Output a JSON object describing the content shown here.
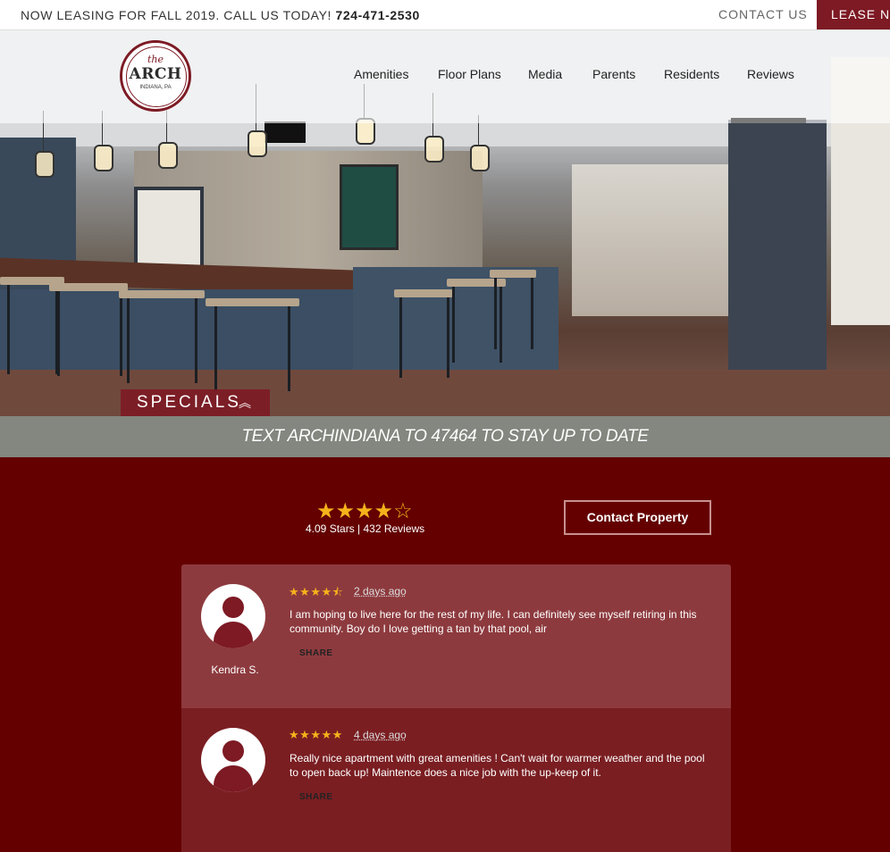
{
  "topbar": {
    "message": "NOW LEASING FOR FALL 2019. CALL US TODAY!",
    "phone": "724-471-2530",
    "contact_label": "CONTACT US",
    "lease_label": "LEASE NOW"
  },
  "logo": {
    "the": "the",
    "name": "ARCH",
    "location": "INDIANA, PA"
  },
  "nav": {
    "items": [
      {
        "label": "Amenities"
      },
      {
        "label": "Floor Plans"
      },
      {
        "label": "Media"
      },
      {
        "label": "Parents"
      },
      {
        "label": "Residents"
      },
      {
        "label": "Reviews"
      }
    ],
    "active": "Reviews"
  },
  "specials": {
    "label": "SPECIALS",
    "chevron": "︽"
  },
  "banner": {
    "text": "TEXT ARCHINDIANA TO 47464 TO STAY UP TO DATE"
  },
  "rating": {
    "stars": 4.09,
    "summary": "4.09 Stars | 432 Reviews",
    "contact_button": "Contact Property"
  },
  "reviews": [
    {
      "name": "Kendra S.",
      "rating": 4.5,
      "date": "2 days ago",
      "text": "I am hoping to live here for the rest of my life. I can definitely see myself retiring in this community. Boy do I love getting a tan by that pool, air",
      "share": "SHARE"
    },
    {
      "name": "",
      "rating": 5,
      "date": "4 days ago",
      "text": "Really nice apartment with great amenities ! Can't wait for warmer weather and the pool to open back up! Maintence does a nice job with the up-keep of it.",
      "share": "SHARE"
    }
  ],
  "colors": {
    "brand": "#7d1a24",
    "page_bg": "#640000",
    "banner_bg": "#83877f",
    "star": "#f6b21b"
  }
}
